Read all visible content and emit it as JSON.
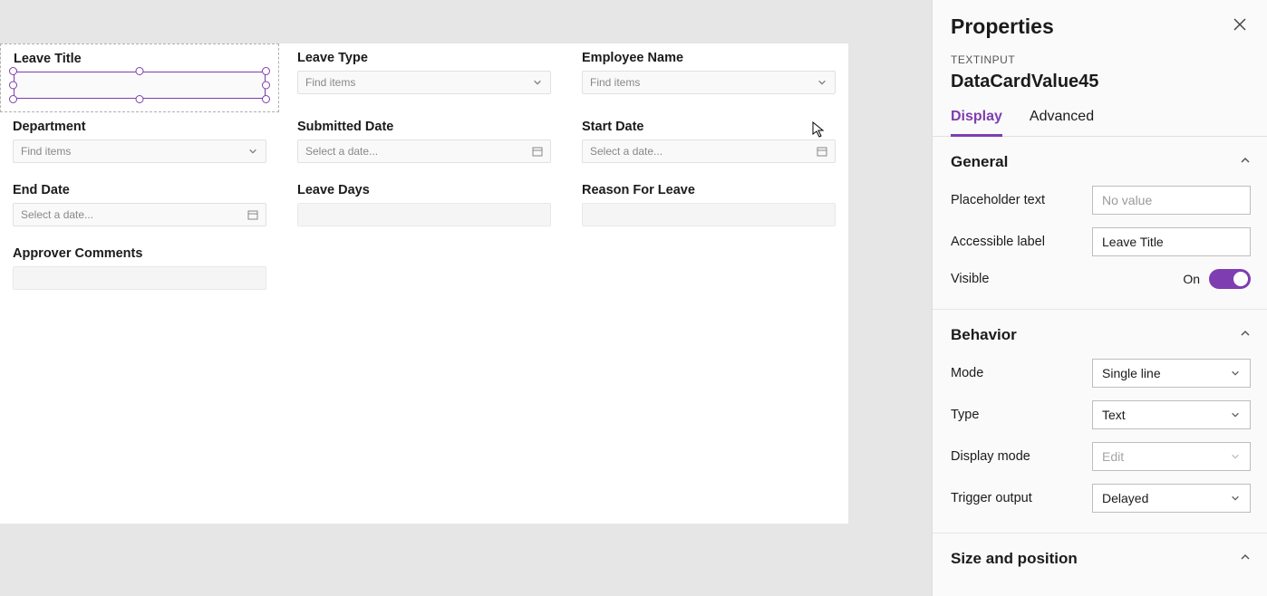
{
  "form": {
    "cards": [
      {
        "label": "Leave Title"
      },
      {
        "label": "Leave Type",
        "placeholder": "Find items"
      },
      {
        "label": "Employee Name",
        "placeholder": "Find items"
      },
      {
        "label": "Department",
        "placeholder": "Find items"
      },
      {
        "label": "Submitted Date",
        "placeholder": "Select a date..."
      },
      {
        "label": "Start Date",
        "placeholder": "Select a date..."
      },
      {
        "label": "End Date",
        "placeholder": "Select a date..."
      },
      {
        "label": "Leave Days"
      },
      {
        "label": "Reason For Leave"
      },
      {
        "label": "Approver Comments"
      }
    ]
  },
  "properties": {
    "panel_title": "Properties",
    "control_type": "TEXTINPUT",
    "control_name": "DataCardValue45",
    "tabs": {
      "display": "Display",
      "advanced": "Advanced"
    },
    "sections": {
      "general": {
        "title": "General",
        "rows": {
          "placeholder_text": {
            "label": "Placeholder text",
            "placeholder": "No value",
            "value": ""
          },
          "accessible_label": {
            "label": "Accessible label",
            "value": "Leave Title"
          },
          "visible": {
            "label": "Visible",
            "state_label": "On"
          }
        }
      },
      "behavior": {
        "title": "Behavior",
        "rows": {
          "mode": {
            "label": "Mode",
            "value": "Single line"
          },
          "type": {
            "label": "Type",
            "value": "Text"
          },
          "display_mode": {
            "label": "Display mode",
            "value": "Edit"
          },
          "trigger_output": {
            "label": "Trigger output",
            "value": "Delayed"
          }
        }
      },
      "size_position": {
        "title": "Size and position"
      }
    }
  }
}
